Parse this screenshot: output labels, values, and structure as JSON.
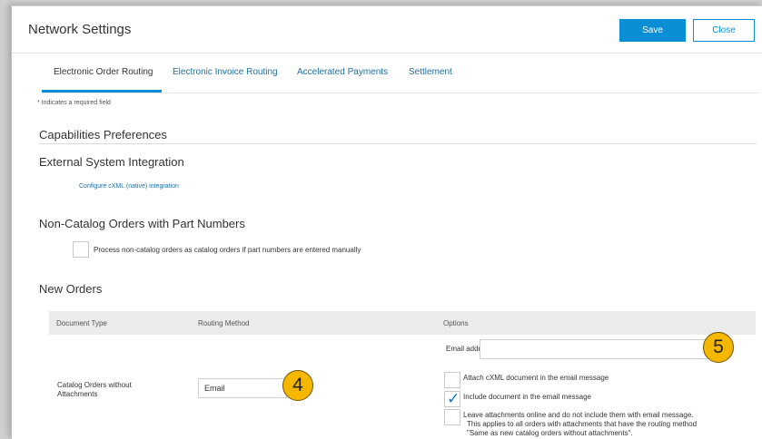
{
  "header": {
    "title": "Network Settings",
    "save_label": "Save",
    "close_label": "Close"
  },
  "tabs": [
    {
      "label": "Electronic Order Routing",
      "active": true
    },
    {
      "label": "Electronic Invoice Routing",
      "active": false
    },
    {
      "label": "Accelerated Payments",
      "active": false
    },
    {
      "label": "Settlement",
      "active": false
    }
  ],
  "required_note": "* Indicates a required field",
  "sections": {
    "capabilities": "Capabilities Preferences",
    "external": "External System Integration",
    "external_link": "Configure cXML (native) integration",
    "noncatalog": "Non-Catalog Orders with Part Numbers",
    "noncatalog_checkbox_label": "Process non-catalog orders as catalog orders if part numbers are entered manually",
    "new_orders": "New Orders"
  },
  "table": {
    "headers": [
      "Document Type",
      "Routing Method",
      "Options"
    ],
    "row": {
      "document_type_line1": "Catalog Orders without",
      "document_type_line2": "Attachments",
      "routing_method": "Email",
      "email_label": "Email address:",
      "email_value": "",
      "options": [
        {
          "label": "Attach cXML document in the email message",
          "checked": false
        },
        {
          "label": "Include document in the email message",
          "checked": true
        },
        {
          "line1": "Leave attachments online and do not include them with email message.",
          "line2": "This applies to all orders with attachments that have the routing method",
          "line3": "\"Same as new catalog orders without attachments\".",
          "checked": false
        }
      ]
    }
  },
  "callouts": {
    "routing": "4",
    "email": "5"
  },
  "colors": {
    "accent": "#0a8fd6",
    "callout": "#f5b700",
    "link": "#1f6fa3"
  }
}
